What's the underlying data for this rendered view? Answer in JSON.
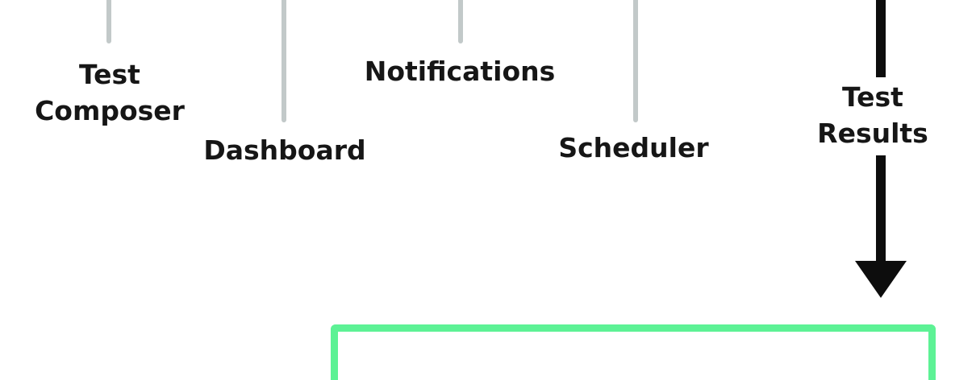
{
  "nodes": {
    "test_composer": {
      "line1": "Test",
      "line2": "Composer"
    },
    "dashboard": {
      "label": "Dashboard"
    },
    "notifications": {
      "label": "Notifications"
    },
    "scheduler": {
      "label": "Scheduler"
    },
    "test_results": {
      "line1": "Test",
      "line2": "Results"
    }
  },
  "colors": {
    "connector": "#c2c9c9",
    "arrow": "#0d0d0d",
    "results_box_border": "#5df295",
    "text": "#161616"
  }
}
